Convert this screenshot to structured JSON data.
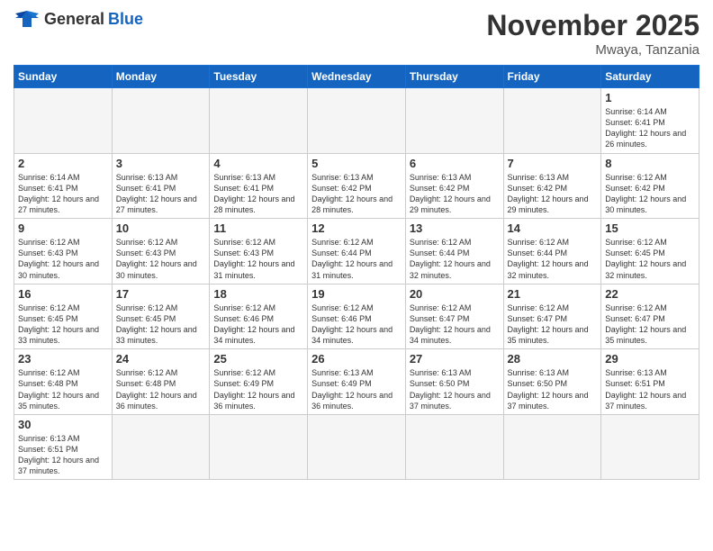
{
  "logo": {
    "text_general": "General",
    "text_blue": "Blue"
  },
  "header": {
    "month_year": "November 2025",
    "location": "Mwaya, Tanzania"
  },
  "weekdays": [
    "Sunday",
    "Monday",
    "Tuesday",
    "Wednesday",
    "Thursday",
    "Friday",
    "Saturday"
  ],
  "days": {
    "d1": {
      "num": "1",
      "sunrise": "6:14 AM",
      "sunset": "6:41 PM",
      "daylight": "12 hours and 26 minutes."
    },
    "d2": {
      "num": "2",
      "sunrise": "6:14 AM",
      "sunset": "6:41 PM",
      "daylight": "12 hours and 27 minutes."
    },
    "d3": {
      "num": "3",
      "sunrise": "6:13 AM",
      "sunset": "6:41 PM",
      "daylight": "12 hours and 27 minutes."
    },
    "d4": {
      "num": "4",
      "sunrise": "6:13 AM",
      "sunset": "6:41 PM",
      "daylight": "12 hours and 28 minutes."
    },
    "d5": {
      "num": "5",
      "sunrise": "6:13 AM",
      "sunset": "6:42 PM",
      "daylight": "12 hours and 28 minutes."
    },
    "d6": {
      "num": "6",
      "sunrise": "6:13 AM",
      "sunset": "6:42 PM",
      "daylight": "12 hours and 29 minutes."
    },
    "d7": {
      "num": "7",
      "sunrise": "6:13 AM",
      "sunset": "6:42 PM",
      "daylight": "12 hours and 29 minutes."
    },
    "d8": {
      "num": "8",
      "sunrise": "6:12 AM",
      "sunset": "6:42 PM",
      "daylight": "12 hours and 30 minutes."
    },
    "d9": {
      "num": "9",
      "sunrise": "6:12 AM",
      "sunset": "6:43 PM",
      "daylight": "12 hours and 30 minutes."
    },
    "d10": {
      "num": "10",
      "sunrise": "6:12 AM",
      "sunset": "6:43 PM",
      "daylight": "12 hours and 30 minutes."
    },
    "d11": {
      "num": "11",
      "sunrise": "6:12 AM",
      "sunset": "6:43 PM",
      "daylight": "12 hours and 31 minutes."
    },
    "d12": {
      "num": "12",
      "sunrise": "6:12 AM",
      "sunset": "6:44 PM",
      "daylight": "12 hours and 31 minutes."
    },
    "d13": {
      "num": "13",
      "sunrise": "6:12 AM",
      "sunset": "6:44 PM",
      "daylight": "12 hours and 32 minutes."
    },
    "d14": {
      "num": "14",
      "sunrise": "6:12 AM",
      "sunset": "6:44 PM",
      "daylight": "12 hours and 32 minutes."
    },
    "d15": {
      "num": "15",
      "sunrise": "6:12 AM",
      "sunset": "6:45 PM",
      "daylight": "12 hours and 32 minutes."
    },
    "d16": {
      "num": "16",
      "sunrise": "6:12 AM",
      "sunset": "6:45 PM",
      "daylight": "12 hours and 33 minutes."
    },
    "d17": {
      "num": "17",
      "sunrise": "6:12 AM",
      "sunset": "6:45 PM",
      "daylight": "12 hours and 33 minutes."
    },
    "d18": {
      "num": "18",
      "sunrise": "6:12 AM",
      "sunset": "6:46 PM",
      "daylight": "12 hours and 34 minutes."
    },
    "d19": {
      "num": "19",
      "sunrise": "6:12 AM",
      "sunset": "6:46 PM",
      "daylight": "12 hours and 34 minutes."
    },
    "d20": {
      "num": "20",
      "sunrise": "6:12 AM",
      "sunset": "6:47 PM",
      "daylight": "12 hours and 34 minutes."
    },
    "d21": {
      "num": "21",
      "sunrise": "6:12 AM",
      "sunset": "6:47 PM",
      "daylight": "12 hours and 35 minutes."
    },
    "d22": {
      "num": "22",
      "sunrise": "6:12 AM",
      "sunset": "6:47 PM",
      "daylight": "12 hours and 35 minutes."
    },
    "d23": {
      "num": "23",
      "sunrise": "6:12 AM",
      "sunset": "6:48 PM",
      "daylight": "12 hours and 35 minutes."
    },
    "d24": {
      "num": "24",
      "sunrise": "6:12 AM",
      "sunset": "6:48 PM",
      "daylight": "12 hours and 36 minutes."
    },
    "d25": {
      "num": "25",
      "sunrise": "6:12 AM",
      "sunset": "6:49 PM",
      "daylight": "12 hours and 36 minutes."
    },
    "d26": {
      "num": "26",
      "sunrise": "6:13 AM",
      "sunset": "6:49 PM",
      "daylight": "12 hours and 36 minutes."
    },
    "d27": {
      "num": "27",
      "sunrise": "6:13 AM",
      "sunset": "6:50 PM",
      "daylight": "12 hours and 37 minutes."
    },
    "d28": {
      "num": "28",
      "sunrise": "6:13 AM",
      "sunset": "6:50 PM",
      "daylight": "12 hours and 37 minutes."
    },
    "d29": {
      "num": "29",
      "sunrise": "6:13 AM",
      "sunset": "6:51 PM",
      "daylight": "12 hours and 37 minutes."
    },
    "d30": {
      "num": "30",
      "sunrise": "6:13 AM",
      "sunset": "6:51 PM",
      "daylight": "12 hours and 37 minutes."
    }
  }
}
